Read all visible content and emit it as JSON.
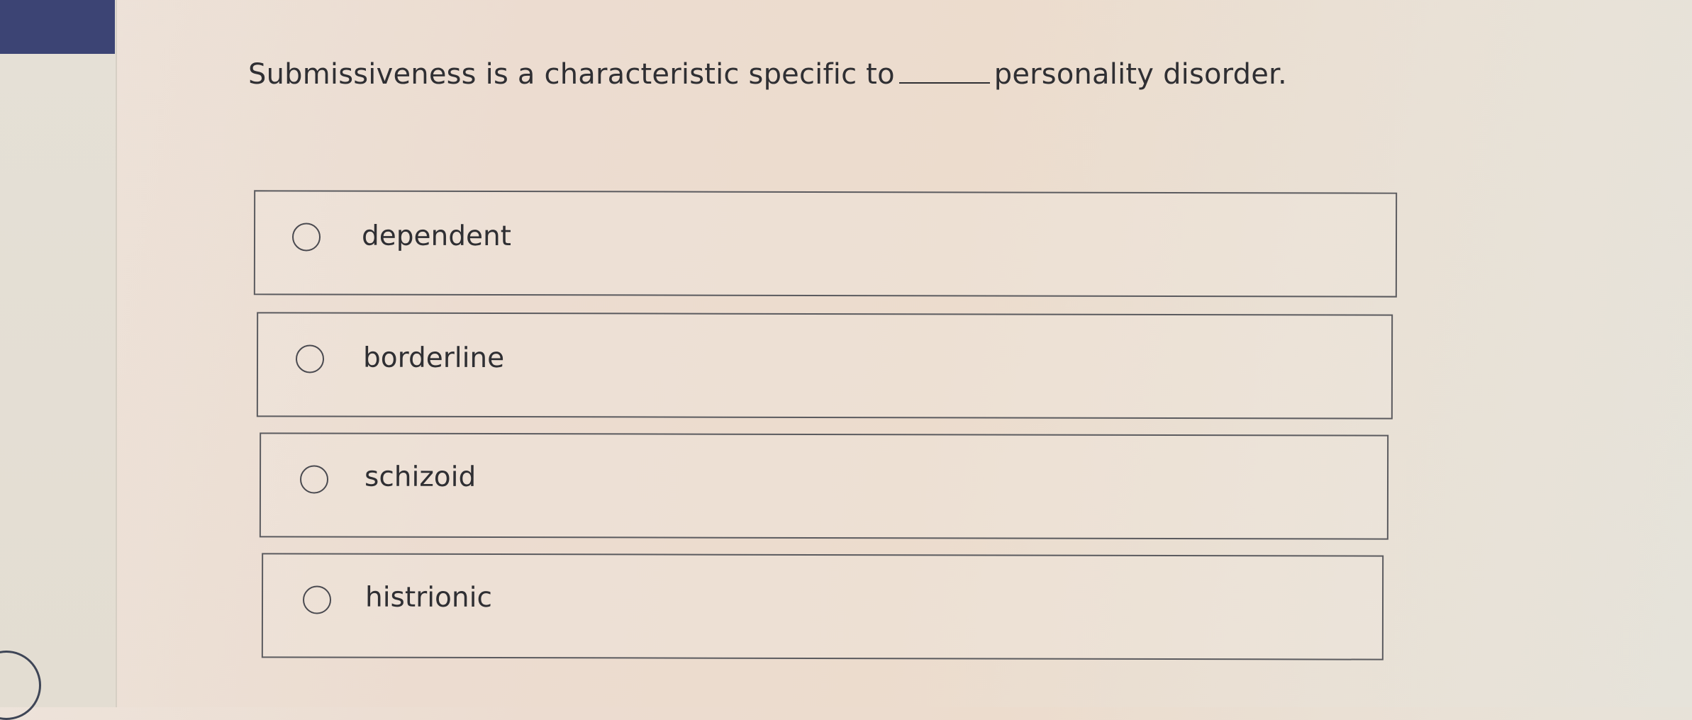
{
  "question": {
    "text_before": "Submissiveness is a characteristic specific to",
    "text_after": "personality disorder."
  },
  "options": [
    {
      "label": "dependent",
      "selected": false
    },
    {
      "label": "borderline",
      "selected": false
    },
    {
      "label": "schizoid",
      "selected": false
    },
    {
      "label": "histrionic",
      "selected": false
    }
  ],
  "colors": {
    "nav_block": "#3c4474",
    "text": "#2f2f33",
    "border": "#5b5b5f"
  },
  "icons": {
    "radio": "radio-unchecked-icon",
    "corner": "circle-icon"
  }
}
